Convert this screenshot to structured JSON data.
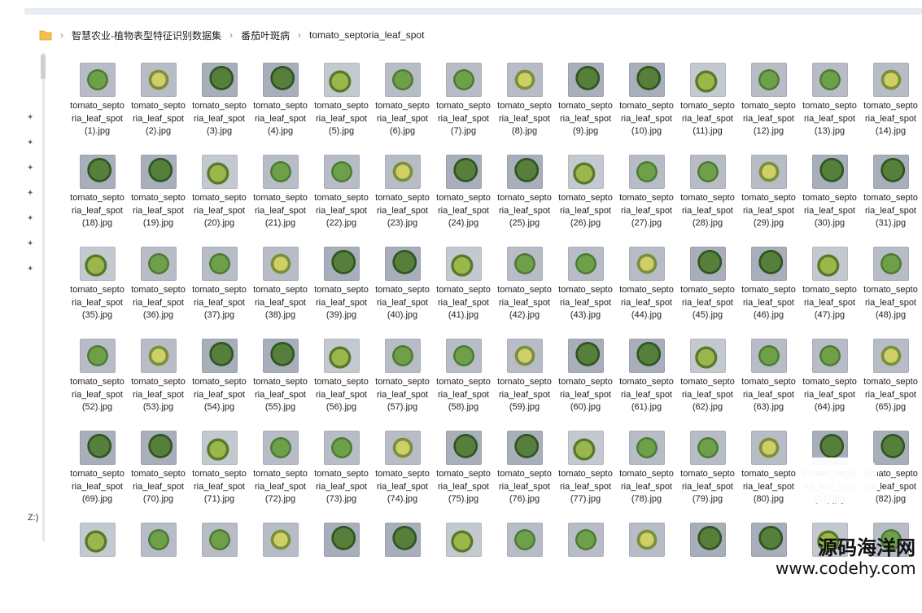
{
  "breadcrumb": {
    "items": [
      "智慧农业-植物表型特征识别数据集",
      "番茄叶斑病",
      "tomato_septoria_leaf_spot"
    ]
  },
  "sidebar": {
    "drive_label": "Z:)"
  },
  "files": [
    "tomato_septoria_leaf_spot(1).jpg",
    "tomato_septoria_leaf_spot(2).jpg",
    "tomato_septoria_leaf_spot(3).jpg",
    "tomato_septoria_leaf_spot(4).jpg",
    "tomato_septoria_leaf_spot(5).jpg",
    "tomato_septoria_leaf_spot(6).jpg",
    "tomato_septoria_leaf_spot(7).jpg",
    "tomato_septoria_leaf_spot(8).jpg",
    "tomato_septoria_leaf_spot(9).jpg",
    "tomato_septoria_leaf_spot(10).jpg",
    "tomato_septoria_leaf_spot(11).jpg",
    "tomato_septoria_leaf_spot(12).jpg",
    "tomato_septoria_leaf_spot(13).jpg",
    "tomato_septoria_leaf_spot(14).jpg",
    "tomato_septoria_leaf_spot(18).jpg",
    "tomato_septoria_leaf_spot(19).jpg",
    "tomato_septoria_leaf_spot(20).jpg",
    "tomato_septoria_leaf_spot(21).jpg",
    "tomato_septoria_leaf_spot(22).jpg",
    "tomato_septoria_leaf_spot(23).jpg",
    "tomato_septoria_leaf_spot(24).jpg",
    "tomato_septoria_leaf_spot(25).jpg",
    "tomato_septoria_leaf_spot(26).jpg",
    "tomato_septoria_leaf_spot(27).jpg",
    "tomato_septoria_leaf_spot(28).jpg",
    "tomato_septoria_leaf_spot(29).jpg",
    "tomato_septoria_leaf_spot(30).jpg",
    "tomato_septoria_leaf_spot(31).jpg",
    "tomato_septoria_leaf_spot(35).jpg",
    "tomato_septoria_leaf_spot(36).jpg",
    "tomato_septoria_leaf_spot(37).jpg",
    "tomato_septoria_leaf_spot(38).jpg",
    "tomato_septoria_leaf_spot(39).jpg",
    "tomato_septoria_leaf_spot(40).jpg",
    "tomato_septoria_leaf_spot(41).jpg",
    "tomato_septoria_leaf_spot(42).jpg",
    "tomato_septoria_leaf_spot(43).jpg",
    "tomato_septoria_leaf_spot(44).jpg",
    "tomato_septoria_leaf_spot(45).jpg",
    "tomato_septoria_leaf_spot(46).jpg",
    "tomato_septoria_leaf_spot(47).jpg",
    "tomato_septoria_leaf_spot(48).jpg",
    "tomato_septoria_leaf_spot(52).jpg",
    "tomato_septoria_leaf_spot(53).jpg",
    "tomato_septoria_leaf_spot(54).jpg",
    "tomato_septoria_leaf_spot(55).jpg",
    "tomato_septoria_leaf_spot(56).jpg",
    "tomato_septoria_leaf_spot(57).jpg",
    "tomato_septoria_leaf_spot(58).jpg",
    "tomato_septoria_leaf_spot(59).jpg",
    "tomato_septoria_leaf_spot(60).jpg",
    "tomato_septoria_leaf_spot(61).jpg",
    "tomato_septoria_leaf_spot(62).jpg",
    "tomato_septoria_leaf_spot(63).jpg",
    "tomato_septoria_leaf_spot(64).jpg",
    "tomato_septoria_leaf_spot(65).jpg",
    "tomato_septoria_leaf_spot(69).jpg",
    "tomato_septoria_leaf_spot(70).jpg",
    "tomato_septoria_leaf_spot(71).jpg",
    "tomato_septoria_leaf_spot(72).jpg",
    "tomato_septoria_leaf_spot(73).jpg",
    "tomato_septoria_leaf_spot(74).jpg",
    "tomato_septoria_leaf_spot(75).jpg",
    "tomato_septoria_leaf_spot(76).jpg",
    "tomato_septoria_leaf_spot(77).jpg",
    "tomato_septoria_leaf_spot(78).jpg",
    "tomato_septoria_leaf_spot(79).jpg",
    "tomato_septoria_leaf_spot(80).jpg",
    "tomato_septoria_leaf_spot(81).jpg",
    "tomato_septoria_leaf_spot(82).jpg",
    "",
    "",
    "",
    "",
    "",
    "",
    "",
    "",
    "",
    "",
    "",
    "",
    "",
    ""
  ],
  "watermark": {
    "line1": "源码海洋网",
    "line2": "www.codehy.com"
  }
}
